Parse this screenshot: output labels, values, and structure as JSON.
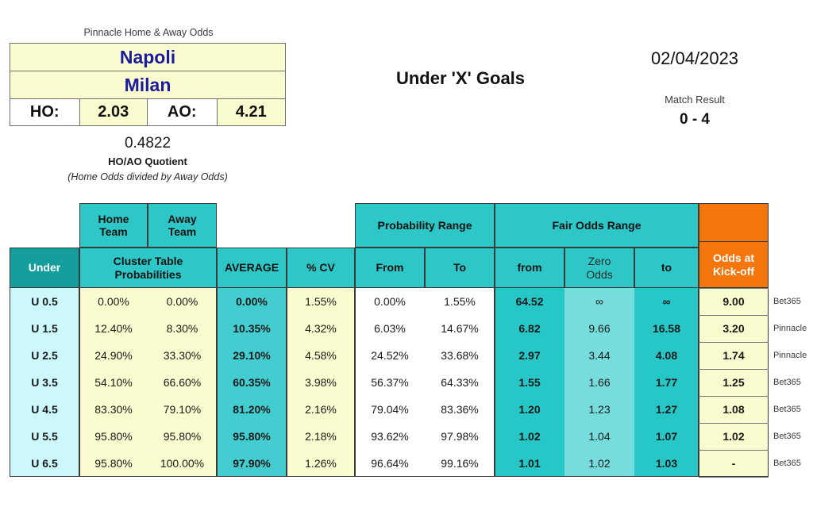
{
  "header": {
    "odds_caption": "Pinnacle Home & Away Odds",
    "home_team": "Napoli",
    "away_team": "Milan",
    "ho_label": "HO:",
    "ho_value": "2.03",
    "ao_label": "AO:",
    "ao_value": "4.21",
    "quotient_value": "0.4822",
    "quotient_label": "HO/AO Quotient",
    "quotient_note": "(Home Odds divided by Away Odds)",
    "title": "Under 'X' Goals",
    "date": "02/04/2023",
    "match_result_label": "Match Result",
    "match_result": "0 - 4"
  },
  "table": {
    "group_headers": {
      "home_team": "Home\nTeam",
      "away_team": "Away\nTeam",
      "probability_range": "Probability Range",
      "fair_odds_range": "Fair Odds Range"
    },
    "columns": {
      "under": "Under",
      "cluster": "Cluster Table\nProbabilities",
      "average": "AVERAGE",
      "cv": "% CV",
      "prob_from": "From",
      "prob_to": "To",
      "odds_from": "from",
      "zero_odds": "Zero\nOdds",
      "odds_to": "to",
      "kickoff": "Odds at\nKick-off"
    },
    "rows": [
      {
        "under": "U 0.5",
        "home": "0.00%",
        "away": "0.00%",
        "average": "0.00%",
        "cv": "1.55%",
        "prob_from": "0.00%",
        "prob_to": "1.55%",
        "odds_from": "64.52",
        "zero_odds": "∞",
        "odds_to": "∞",
        "kickoff": "9.00",
        "book": "Bet365"
      },
      {
        "under": "U 1.5",
        "home": "12.40%",
        "away": "8.30%",
        "average": "10.35%",
        "cv": "4.32%",
        "prob_from": "6.03%",
        "prob_to": "14.67%",
        "odds_from": "6.82",
        "zero_odds": "9.66",
        "odds_to": "16.58",
        "kickoff": "3.20",
        "book": "Pinnacle"
      },
      {
        "under": "U 2.5",
        "home": "24.90%",
        "away": "33.30%",
        "average": "29.10%",
        "cv": "4.58%",
        "prob_from": "24.52%",
        "prob_to": "33.68%",
        "odds_from": "2.97",
        "zero_odds": "3.44",
        "odds_to": "4.08",
        "kickoff": "1.74",
        "book": "Pinnacle"
      },
      {
        "under": "U 3.5",
        "home": "54.10%",
        "away": "66.60%",
        "average": "60.35%",
        "cv": "3.98%",
        "prob_from": "56.37%",
        "prob_to": "64.33%",
        "odds_from": "1.55",
        "zero_odds": "1.66",
        "odds_to": "1.77",
        "kickoff": "1.25",
        "book": "Bet365"
      },
      {
        "under": "U 4.5",
        "home": "83.30%",
        "away": "79.10%",
        "average": "81.20%",
        "cv": "2.16%",
        "prob_from": "79.04%",
        "prob_to": "83.36%",
        "odds_from": "1.20",
        "zero_odds": "1.23",
        "odds_to": "1.27",
        "kickoff": "1.08",
        "book": "Bet365"
      },
      {
        "under": "U 5.5",
        "home": "95.80%",
        "away": "95.80%",
        "average": "95.80%",
        "cv": "2.18%",
        "prob_from": "93.62%",
        "prob_to": "97.98%",
        "odds_from": "1.02",
        "zero_odds": "1.04",
        "odds_to": "1.07",
        "kickoff": "1.02",
        "book": "Bet365"
      },
      {
        "under": "U 6.5",
        "home": "95.80%",
        "away": "100.00%",
        "average": "97.90%",
        "cv": "1.26%",
        "prob_from": "96.64%",
        "prob_to": "99.16%",
        "odds_from": "1.01",
        "zero_odds": "1.02",
        "odds_to": "1.03",
        "kickoff": "-",
        "book": "Bet365"
      }
    ]
  },
  "colors": {
    "teal_dark": "#149e9e",
    "teal": "#2ec7c7",
    "teal_light": "#76dcdc",
    "orange": "#f4760c",
    "cream": "#fbfbd0",
    "ice": "#ccf7fb",
    "team_blue": "#1b1b9e"
  }
}
